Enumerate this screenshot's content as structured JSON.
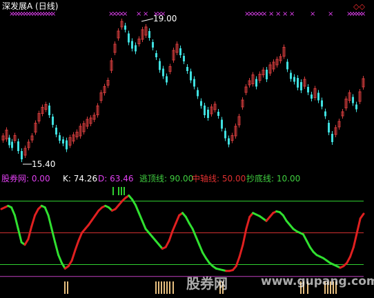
{
  "window": {
    "title": "深发展A (日线)",
    "top_right_marker": "◇◇"
  },
  "price_panel": {
    "high_label": "19.00",
    "low_label": "15.40",
    "colors": {
      "up": "#d23c3c",
      "down": "#40e0e0",
      "signal": "#e040f0"
    }
  },
  "indicator_panel": {
    "labels": [
      {
        "name": "股券网",
        "value": "0.00",
        "color": "#e040f0"
      },
      {
        "name": "K",
        "value": "74.26",
        "color": "#ffffff"
      },
      {
        "name": "D",
        "value": "63.46",
        "color": "#e040f0"
      },
      {
        "name": "逃顶线",
        "value": "90.00",
        "color": "#40d040"
      },
      {
        "name": "中轴线",
        "value": "50.00",
        "color": "#e03030"
      },
      {
        "name": "抄底线",
        "value": "10.00",
        "color": "#40d040"
      }
    ],
    "colors": {
      "k_up": "#e02020",
      "k_down": "#30e030",
      "top_line": "#30d030",
      "mid_line": "#d03030",
      "bottom_line": "#30d030",
      "zero_line": "#c040c0",
      "bar": "#e8c080"
    }
  },
  "chart_data": {
    "type": "line",
    "title": "",
    "series": [
      {
        "name": "K",
        "values": [
          80,
          82,
          84,
          82,
          72,
          55,
          38,
          35,
          42,
          58,
          72,
          80,
          84,
          82,
          72,
          55,
          38,
          22,
          12,
          5,
          8,
          15,
          28,
          40,
          50,
          55,
          60,
          66,
          72,
          78,
          82,
          84,
          82,
          78,
          80,
          85,
          90,
          94,
          97,
          92,
          85,
          75,
          65,
          55,
          50,
          45,
          40,
          35,
          30,
          32,
          40,
          52,
          62,
          72,
          75,
          70,
          62,
          55,
          45,
          35,
          25,
          18,
          12,
          8,
          5,
          4,
          3,
          2,
          2,
          3,
          8,
          20,
          35,
          55,
          70,
          75,
          73,
          71,
          68,
          65,
          70,
          75,
          77,
          76,
          72,
          65,
          60,
          55,
          52,
          50,
          48,
          40,
          32,
          26,
          22,
          20,
          18,
          15,
          12,
          10,
          8,
          6,
          8,
          12,
          20,
          32,
          50,
          68,
          74
        ]
      }
    ],
    "ylim": [
      0,
      100
    ],
    "reference_lines": [
      90,
      50,
      10
    ]
  }
}
